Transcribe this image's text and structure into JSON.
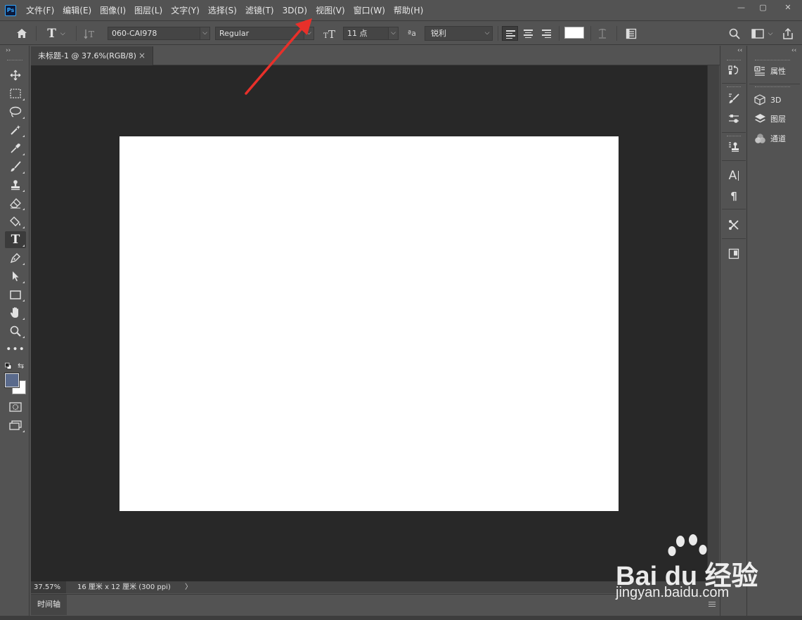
{
  "app": {
    "logo": "Ps",
    "window_controls": [
      "—",
      "▢",
      "✕"
    ]
  },
  "menu": [
    "文件(F)",
    "编辑(E)",
    "图像(I)",
    "图层(L)",
    "文字(Y)",
    "选择(S)",
    "滤镜(T)",
    "3D(D)",
    "视图(V)",
    "窗口(W)",
    "帮助(H)"
  ],
  "options": {
    "font_family": "060-CAI978",
    "font_style": "Regular",
    "font_size": "11 点",
    "aa_label": "ªa",
    "anti_alias": "锐利",
    "text_color": "#ffffff"
  },
  "document": {
    "tab_title": "未标题-1 @ 37.6%(RGB/8)",
    "tab_close": "×",
    "zoom": "37.57%",
    "size_info": "16 厘米 x 12 厘米 (300 ppi)",
    "status_arrow": "〉",
    "canvas_color": "#ffffff"
  },
  "toolbar": {
    "tools": [
      "move",
      "rectangular-marquee",
      "lasso",
      "magic-wand",
      "eyedropper",
      "brush",
      "clone-stamp",
      "eraser",
      "paint-bucket",
      "type",
      "pen",
      "path-selection",
      "rectangle",
      "hand",
      "zoom",
      "more"
    ],
    "active_tool": "type",
    "foreground_color": "#5a6a8c",
    "background_color": "#ffffff"
  },
  "timeline": {
    "label": "时间轴"
  },
  "panels": {
    "properties": "属性",
    "three_d": "3D",
    "layers": "图层",
    "channels": "通道"
  },
  "watermark": {
    "brand": "Bai du 经验",
    "url": "jingyan.baidu.com"
  },
  "annotation": {
    "arrow_color": "#e8302a"
  }
}
